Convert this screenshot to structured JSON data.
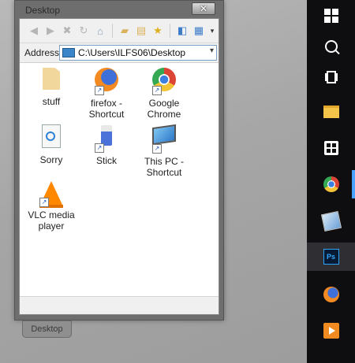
{
  "window": {
    "title": "Desktop",
    "close_label": "✕",
    "address_label": "Address",
    "address_value": "C:\\Users\\ILFS06\\Desktop"
  },
  "toolbar": {
    "icons": [
      "back-icon",
      "forward-icon",
      "stop-icon",
      "refresh-icon",
      "home-icon",
      "folder-up-icon",
      "folders-icon",
      "favorites-icon",
      "move-to-icon",
      "views-icon"
    ]
  },
  "items": [
    {
      "label": "stuff",
      "icon": "folder-icon"
    },
    {
      "label": "firefox - Shortcut",
      "icon": "firefox-icon"
    },
    {
      "label": "Google Chrome",
      "icon": "chrome-icon"
    },
    {
      "label": "Sorry",
      "icon": "document-icon"
    },
    {
      "label": "Stick",
      "icon": "stick-icon"
    },
    {
      "label": "This PC - Shortcut",
      "icon": "this-pc-icon"
    },
    {
      "label": "VLC media player",
      "icon": "vlc-icon"
    }
  ],
  "bottom_tab": "Desktop",
  "taskbar": {
    "icons": [
      "windows-start-icon",
      "search-icon",
      "task-view-icon",
      "file-explorer-icon",
      "store-icon",
      "chrome-icon",
      "paintbrush-icon",
      "photoshop-icon",
      "firefox-icon",
      "powerpoint-icon"
    ],
    "photoshop_label": "Ps"
  }
}
